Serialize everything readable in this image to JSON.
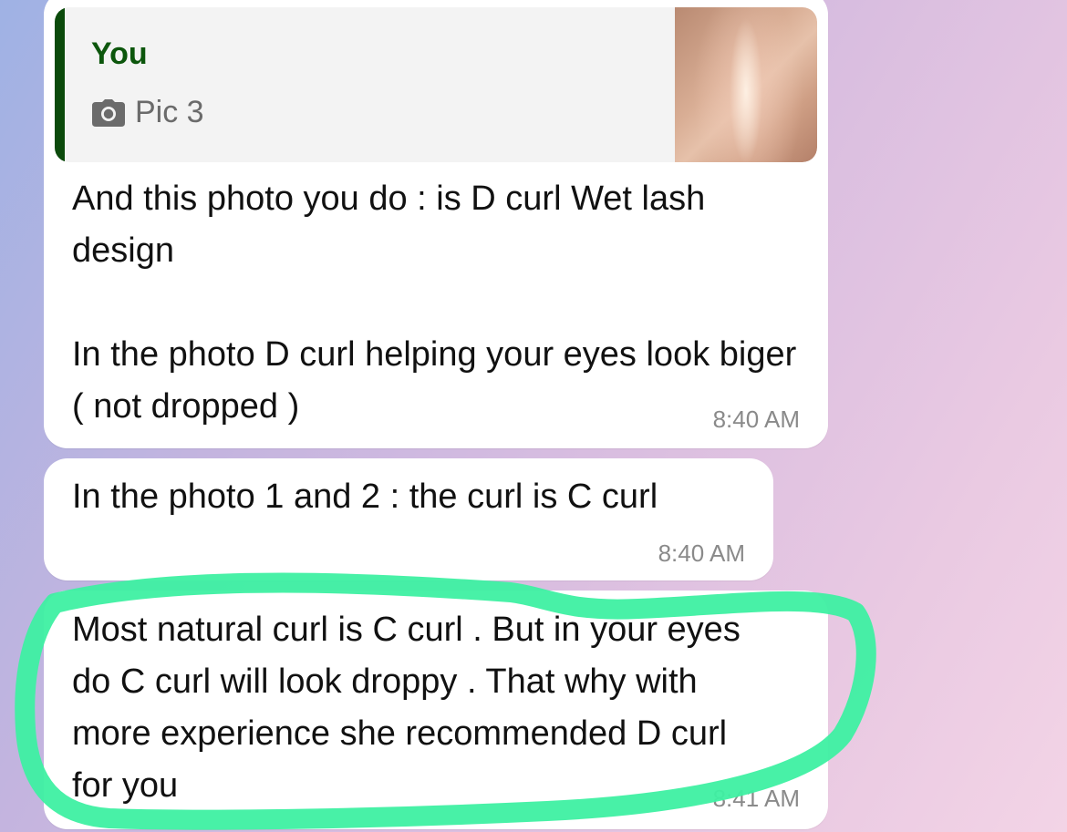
{
  "messages": [
    {
      "reply": {
        "sender": "You",
        "caption": "Pic 3",
        "icon": "camera-icon",
        "sender_color": "#0c560c",
        "bar_color": "#0b4a0b"
      },
      "text": "And this photo you do : is D curl Wet lash design\n\nIn the photo D curl helping your eyes look biger ( not dropped )",
      "time": "8:40 AM"
    },
    {
      "text": "In the photo 1 and 2 : the curl is C curl",
      "time": "8:40 AM"
    },
    {
      "text": "Most natural curl is C curl . But in your eyes do C curl will look droppy . That why with more experience she recommended D curl for you",
      "time": "8:41 AM"
    }
  ],
  "annotation": {
    "type": "hand-drawn highlight",
    "color": "#3ef0a2"
  }
}
